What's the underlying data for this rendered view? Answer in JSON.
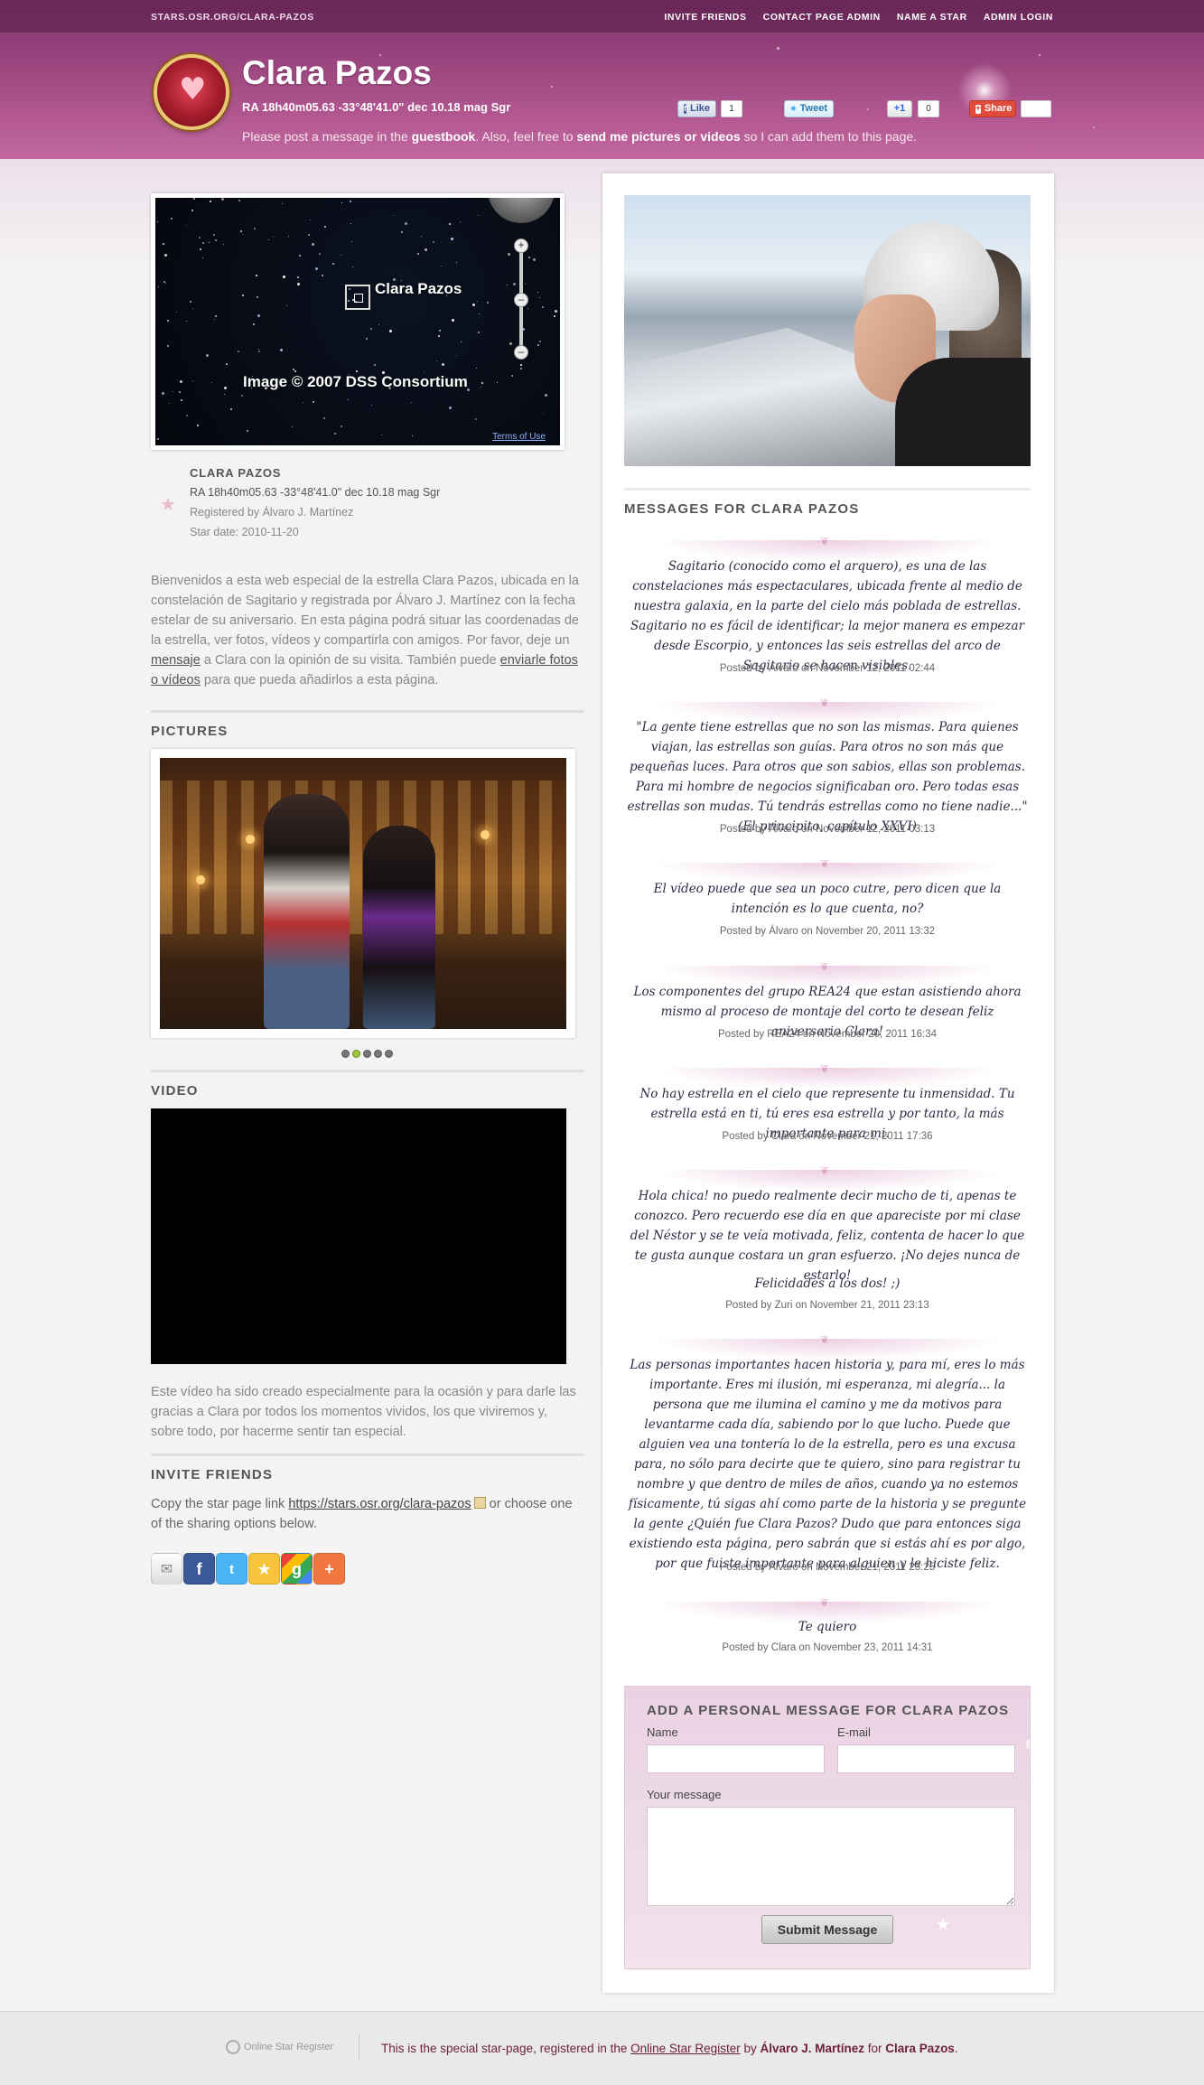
{
  "topbar": {
    "url": "STARS.OSR.ORG/CLARA-PAZOS",
    "nav": [
      "INVITE FRIENDS",
      "CONTACT PAGE ADMIN",
      "NAME A STAR",
      "ADMIN LOGIN"
    ]
  },
  "header": {
    "title": "Clara Pazos",
    "coords": "RA 18h40m05.63 -33°48'41.0\" dec 10.18 mag Sgr",
    "note_pre": "Please post a message in the ",
    "note_link1": "guestbook",
    "note_mid": ". Also, feel free to ",
    "note_link2": "send me pictures or videos",
    "note_post": " so I can add them to this page.",
    "social": {
      "like_label": "Like",
      "like_count": "1",
      "tweet_label": "Tweet",
      "plusone_label": "+1",
      "plusone_count": "0",
      "share_label": "Share"
    }
  },
  "map": {
    "star_label": "Clara Pazos",
    "credit": "Image © 2007 DSS Consortium",
    "terms": "Terms of Use"
  },
  "star_info": {
    "name": "CLARA PAZOS",
    "coords": "RA 18h40m05.63 -33°48'41.0\" dec 10.18 mag Sgr",
    "registered": "Registered by Álvaro J. Martínez",
    "date": "Star date: 2010-11-20"
  },
  "intro": {
    "part1": "Bienvenidos a esta web especial de la estrella Clara Pazos, ubicada en la constelación de Sagitario y registrada por Álvaro J. Martínez con la fecha estelar de su aniversario. En esta página podrá situar las coordenadas de la estrella, ver fotos, vídeos y compartirla con amigos. Por favor, deje un ",
    "link1": "mensaje",
    "part2": " a Clara con la opinión de su visita. También puede ",
    "link2": "enviarle fotos o vídeos",
    "part3": " para que pueda añadirlos a esta página."
  },
  "pictures": {
    "heading": "PICTURES"
  },
  "video": {
    "heading": "VIDEO",
    "caption": "Este vídeo ha sido creado especialmente para la ocasión y para darle las gracias a Clara por todos los momentos vividos, los que viviremos y, sobre todo, por hacerme sentir tan especial."
  },
  "invite": {
    "heading": "INVITE FRIENDS",
    "text_pre": "Copy the star page link ",
    "link": "https://stars.osr.org/clara-pazos",
    "text_post": " or choose one of the sharing options below."
  },
  "messages": {
    "heading": "MESSAGES FOR CLARA PAZOS",
    "items": [
      {
        "text": "Sagitario (conocido como el arquero), es una de las constelaciones más espectaculares, ubicada frente al medio de nuestra galaxia, en la parte del cielo más poblada de estrellas. Sagitario no es fácil de identificar; la mejor manera es empezar desde Escorpio, y entonces las seis estrellas del arco de Sagitario se hacen visibles.",
        "meta": "Posted by Álvaro on November 12, 2011 02:44"
      },
      {
        "text": "\"La gente tiene estrellas que no son las mismas. Para quienes viajan, las estrellas son guías. Para otros no son más que pequeñas luces. Para otros que son sabios, ellas son problemas. Para mi hombre de negocios significaban oro. Pero todas esas estrellas son mudas. Tú tendrás estrellas como no tiene nadie...\" (El principito, capítulo XXVI)",
        "meta": "Posted by Álvaro on November 12, 2011 03:13"
      },
      {
        "text": "El vídeo puede que sea un poco cutre, pero dicen que la intención es lo que cuenta, no?",
        "meta": "Posted by Álvaro on November 20, 2011 13:32"
      },
      {
        "text": "Los componentes del grupo REA24 que estan asistiendo ahora mismo al proceso de montaje del corto te desean feliz aniversario Clara!",
        "meta": "Posted by REA24 on November 20, 2011 16:34"
      },
      {
        "text": "No hay estrella en el cielo que represente tu inmensidad. Tu estrella está en ti, tú eres esa estrella y por tanto, la más importante para mi.",
        "meta": "Posted by Clara on November 21, 2011 17:36"
      },
      {
        "text": "Hola chica! no puedo realmente decir mucho de ti, apenas te conozco. Pero recuerdo ese día en que apareciste por mi clase del Néstor y se te veía motivada, feliz, contenta de hacer lo que te gusta aunque costara un gran esfuerzo. ¡No dejes nunca de estarlo!",
        "text2": "Felicidades a los dos! ;)",
        "meta": "Posted by Zuri on November 21, 2011 23:13"
      },
      {
        "text": "Las personas importantes hacen historia y, para mí, eres lo más importante. Eres mi ilusión, mi esperanza, mi alegría... la persona que me ilumina el camino y me da motivos para levantarme cada día, sabiendo por lo que lucho. Puede que alguien vea una tontería lo de la estrella, pero es una excusa para, no sólo para decirte que te quiero, sino para registrar tu nombre y que dentro de miles de años, cuando ya no estemos físicamente, tú sigas ahí como parte de la historia y se pregunte la gente ¿Quién fue Clara Pazos? Dudo que para entonces siga existiendo esta página, pero sabrán que si estás ahí es por algo, por que fuiste importante para alguien y le hiciste feliz.",
        "meta": "Posted by Álvaro on November 21, 2011 23:25"
      },
      {
        "text": "Te quiero",
        "meta": "Posted by Clara on November 23, 2011 14:31"
      }
    ]
  },
  "form": {
    "heading": "ADD A PERSONAL MESSAGE FOR CLARA PAZOS",
    "name_label": "Name",
    "email_label": "E-mail",
    "message_label": "Your message",
    "submit_label": "Submit Message"
  },
  "footer": {
    "logo_text": "Online Star Register",
    "text_pre": "This is the special star-page, registered in the ",
    "link": "Online Star Register",
    "text_mid": " by ",
    "owner": "Álvaro J. Martínez",
    "text_for": " for ",
    "star": "Clara Pazos",
    "text_end": "."
  },
  "colors": {
    "header_accent": "#9c4582",
    "message_text": "#2e2a44",
    "footer_text": "#6e1e3a"
  }
}
